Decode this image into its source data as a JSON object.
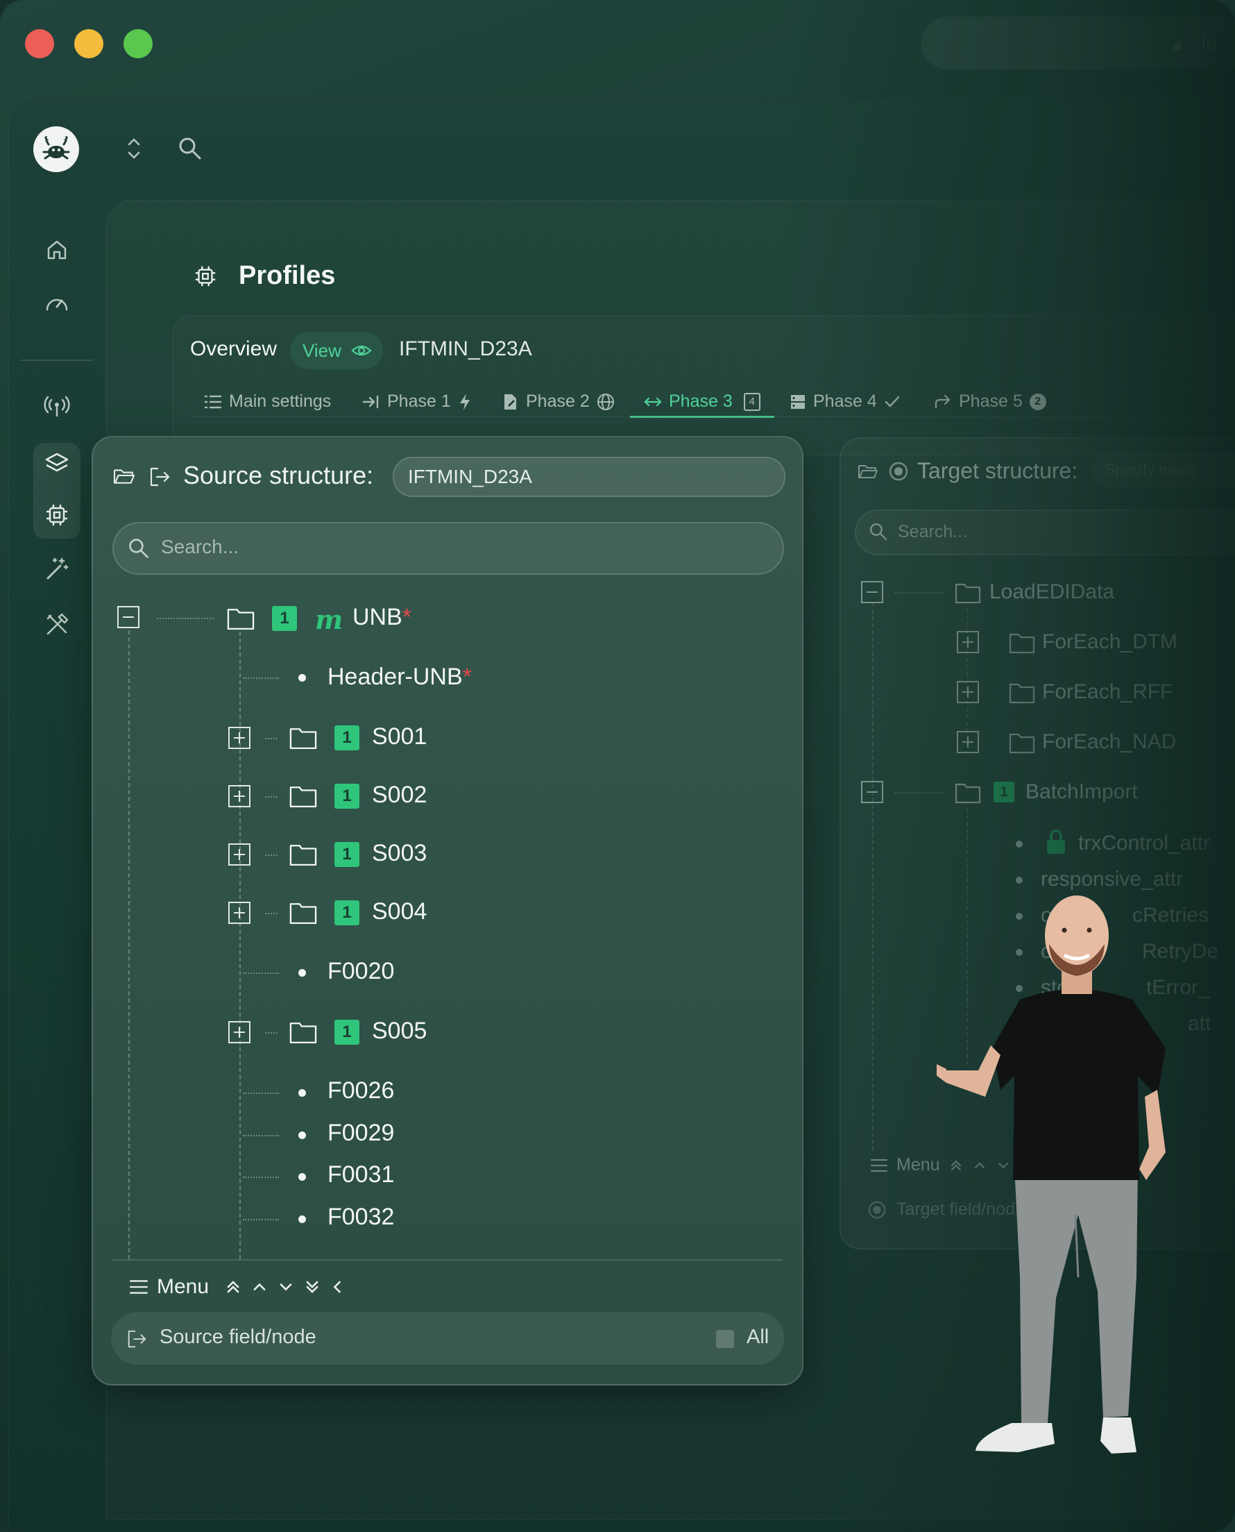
{
  "window": {
    "titlebar_field_label": "lo"
  },
  "header": {
    "page_title": "Profiles"
  },
  "overview": {
    "label": "Overview",
    "view_label": "View",
    "code": "IFTMIN_D23A"
  },
  "tabs": [
    {
      "label": "Main settings"
    },
    {
      "label": "Phase 1"
    },
    {
      "label": "Phase 2"
    },
    {
      "label": "Phase 3",
      "badge": "4"
    },
    {
      "label": "Phase 4"
    },
    {
      "label": "Phase 5",
      "badge": "2"
    }
  ],
  "source": {
    "title": "Source structure:",
    "structure_value": "IFTMIN_D23A",
    "search_placeholder": "Search...",
    "tree": {
      "root": {
        "label": "UNB",
        "required": "*",
        "badge": "1",
        "type_icon": "m"
      },
      "header": {
        "label": "Header-UNB",
        "required": "*"
      },
      "groups": [
        {
          "label": "S001",
          "badge": "1"
        },
        {
          "label": "S002",
          "badge": "1"
        },
        {
          "label": "S003",
          "badge": "1"
        },
        {
          "label": "S004",
          "badge": "1"
        }
      ],
      "field_after_groups": "F0020",
      "group_s005": {
        "label": "S005",
        "badge": "1"
      },
      "fields": [
        "F0026",
        "F0029",
        "F0031",
        "F0032"
      ]
    },
    "menu_label": "Menu",
    "source_field_placeholder": "Source field/node",
    "all_label": "All"
  },
  "target": {
    "title": "Target structure:",
    "spec_placeholder": "Specify mess",
    "search_placeholder": "Search...",
    "tree": {
      "root": "LoadEDIData",
      "children": [
        "ForEach_DTM",
        "ForEach_RFF",
        "ForEach_NAD"
      ],
      "batch": {
        "label": "BatchImport",
        "badge": "1"
      },
      "batch_fields": [
        "trxControl_attr",
        "responsive_attr",
        "opti",
        "cRetries",
        "op",
        "RetryDe",
        "sto",
        "tError_",
        "att"
      ]
    },
    "menu_label": "Menu",
    "field_placeholder": "Target field/nod"
  },
  "colors": {
    "accent": "#3fbf86",
    "badge": "#2fc57a",
    "required": "#e04a4a",
    "traffic_red": "#ec5f57",
    "traffic_yellow": "#f4bb3c",
    "traffic_green": "#5ac84f"
  }
}
